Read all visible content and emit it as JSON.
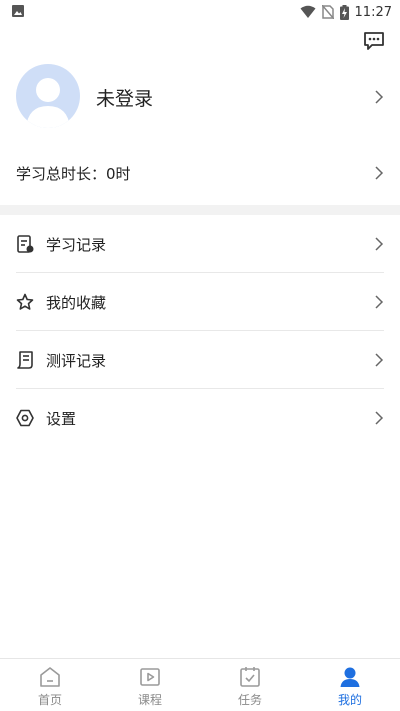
{
  "status_bar": {
    "time": "11:27",
    "icons": [
      "gallery-icon",
      "wifi-icon",
      "no-sim-icon",
      "battery-charging-icon"
    ]
  },
  "header": {
    "message_icon": "message-icon"
  },
  "profile": {
    "login_status": "未登录",
    "avatar_icon": "default-avatar"
  },
  "study": {
    "total_time_label": "学习总时长：0时"
  },
  "menu": {
    "items": [
      {
        "label": "学习记录",
        "icon": "study-record-icon"
      },
      {
        "label": "我的收藏",
        "icon": "star-icon"
      },
      {
        "label": "测评记录",
        "icon": "assessment-record-icon"
      },
      {
        "label": "设置",
        "icon": "settings-icon"
      }
    ]
  },
  "tabbar": {
    "tabs": [
      {
        "label": "首页",
        "icon": "home-icon",
        "active": false
      },
      {
        "label": "课程",
        "icon": "course-icon",
        "active": false
      },
      {
        "label": "任务",
        "icon": "task-icon",
        "active": false
      },
      {
        "label": "我的",
        "icon": "profile-icon",
        "active": true
      }
    ]
  },
  "colors": {
    "accent": "#1e6fe0",
    "avatar_bg": "#cfdef7",
    "inactive": "#8a8a8a",
    "band": "#f2f2f2"
  }
}
